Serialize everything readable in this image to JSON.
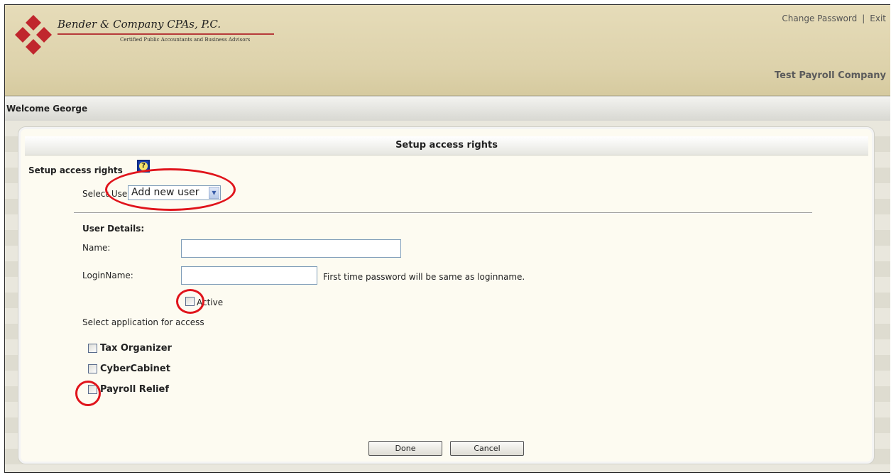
{
  "header": {
    "firm_name": "Bender & Company CPAs, P.C.",
    "firm_tagline": "Certified Public Accountants and Business Advisors",
    "links": {
      "change_password": "Change Password",
      "separator": "|",
      "exit": "Exit"
    },
    "company": "Test Payroll Company"
  },
  "welcome": {
    "text": "Welcome George"
  },
  "panel": {
    "title": "Setup access rights",
    "section_heading": "Setup access rights",
    "help_icon": "help-question-icon",
    "select_user": {
      "label": "Select User:",
      "value": "Add new user"
    },
    "user_details": {
      "heading": "User Details:",
      "name_label": "Name:",
      "name_value": "",
      "login_label": "LoginName:",
      "login_value": "",
      "login_hint": "First time password will be same as loginname.",
      "active_label": "Active",
      "active_checked": false
    },
    "apps_prompt": "Select application for access",
    "applications": [
      {
        "label": "Tax Organizer",
        "checked": false
      },
      {
        "label": "CyberCabinet",
        "checked": false
      },
      {
        "label": "Payroll Relief",
        "checked": false
      }
    ],
    "buttons": {
      "done": "Done",
      "cancel": "Cancel"
    }
  },
  "colors": {
    "header_bg": "#ddd2ab",
    "logo_red": "#c0262d",
    "firm_rule": "#b63a3a",
    "panel_bg": "#fdfbf1",
    "annotation_red": "#e0141c"
  }
}
